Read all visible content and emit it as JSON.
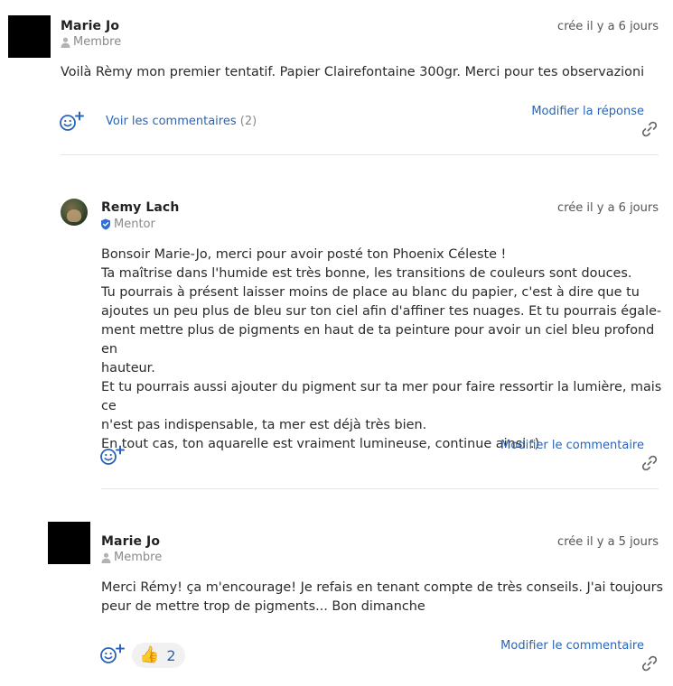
{
  "posts": [
    {
      "author": "Marie Jo",
      "role": "Membre",
      "date": "crée il y a 6 jours",
      "body": [
        "Voilà Rèmy mon premier tentatif. Papier Clairefontaine 300gr.  Merci pour tes observazioni"
      ],
      "view_comments_label": "Voir les commentaires",
      "view_comments_count": "(2)",
      "edit_label": "Modifier la réponse"
    },
    {
      "author": "Remy Lach",
      "role": "Mentor",
      "date": "crée il y a 6 jours",
      "body": [
        "Bonsoir Marie-Jo, merci pour avoir posté ton Phoenix Céleste !",
        "Ta maîtrise dans l'humide est très bonne, les transitions de couleurs sont douces.",
        "Tu pourrais à présent laisser moins de place au blanc du papier, c'est à dire que tu",
        "ajoutes un peu plus de bleu sur ton ciel afin d'affiner tes nuages. Et tu pourrais égale-",
        "ment mettre plus de pigments en haut de ta peinture pour avoir un ciel bleu profond en",
        "hauteur.",
        "Et tu pourrais aussi ajouter du pigment sur ta mer pour faire ressortir la lumière, mais ce",
        "n'est pas indispensable, ta mer est déjà très bien.",
        "En tout cas, ton aquarelle est vraiment lumineuse, continue ainsi :)"
      ],
      "edit_label": "Modifier le commentaire"
    },
    {
      "author": "Marie Jo",
      "role": "Membre",
      "date": "crée il y a 5 jours",
      "body": [
        "Merci Rémy! ça m'encourage! Je refais en tenant compte de très conseils. J'ai toujours",
        "peur de mettre trop de pigments... Bon dimanche"
      ],
      "reaction_emoji": "👍",
      "reaction_count": "2",
      "edit_label": "Modifier le commentaire"
    }
  ],
  "icons": {
    "add_reaction": "add-reaction-icon",
    "link": "link-icon",
    "member": "user-icon",
    "mentor": "verified-shield-icon"
  },
  "colors": {
    "link": "#2a64b8",
    "muted": "#8a8a8a",
    "mentor_badge": "#2f6fd6"
  }
}
